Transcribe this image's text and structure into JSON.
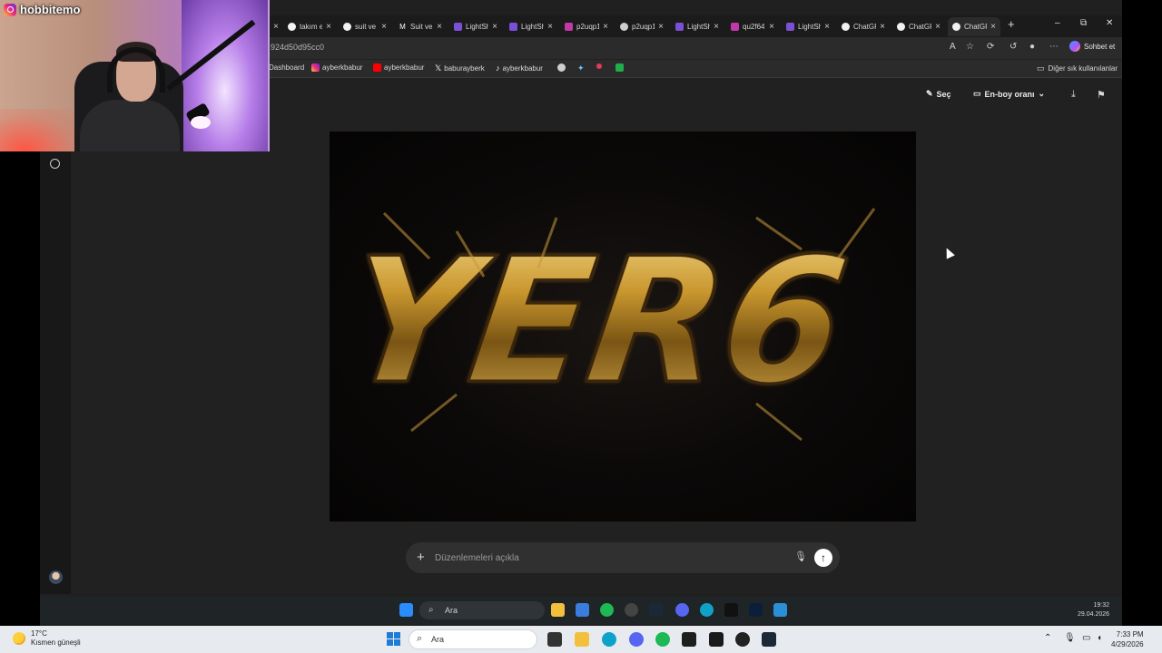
{
  "streamer": {
    "username": "hobbitemo"
  },
  "tabs": [
    {
      "title": "",
      "favicon": "tab-icon"
    },
    {
      "title": "takım e",
      "favicon": "chatgpt-icon"
    },
    {
      "title": "suit ve",
      "favicon": "chatgpt-icon"
    },
    {
      "title": "Suit ve",
      "favicon": "m-icon"
    },
    {
      "title": "LightSh",
      "favicon": "lightshot-icon"
    },
    {
      "title": "LightSh",
      "favicon": "lightshot-icon"
    },
    {
      "title": "p2uqp1",
      "favicon": "p-icon"
    },
    {
      "title": "p2uqp1",
      "favicon": "globe-icon"
    },
    {
      "title": "LightSh",
      "favicon": "lightshot-icon"
    },
    {
      "title": "qu2f64",
      "favicon": "p-icon"
    },
    {
      "title": "LightSh",
      "favicon": "lightshot-icon"
    },
    {
      "title": "ChatGP",
      "favicon": "chatgpt-icon"
    },
    {
      "title": "ChatGP",
      "favicon": "chatgpt-icon"
    },
    {
      "title": "ChatGP",
      "favicon": "chatgpt-icon"
    }
  ],
  "address": {
    "url": "924d50d95cc0",
    "copilot_label": "Sohbet et"
  },
  "bookmarks": [
    {
      "label": "Dashboard",
      "icon": "dashboard-icon"
    },
    {
      "label": "ayberkbabur",
      "icon": "instagram-icon"
    },
    {
      "label": "ayberkbabur",
      "icon": "youtube-icon"
    },
    {
      "label": "baburayberk",
      "icon": "x-icon"
    },
    {
      "label": "ayberkbabur",
      "icon": "tiktok-icon"
    }
  ],
  "bookmarks_other": "Diğer sık kullanılanlar",
  "editor": {
    "select_label": "Seç",
    "aspect_label": "En-boy oranı",
    "image_text": "YER6",
    "prompt_placeholder": "Düzenlemeleri açıkla"
  },
  "inner_taskbar": {
    "search_label": "Ara",
    "time": "19:32",
    "date": "29.04.2026"
  },
  "os_taskbar": {
    "weather_temp": "17°C",
    "weather_desc": "Kısmen güneşli",
    "search_label": "Ara",
    "time": "7:33 PM",
    "date": "4/29/2026"
  }
}
